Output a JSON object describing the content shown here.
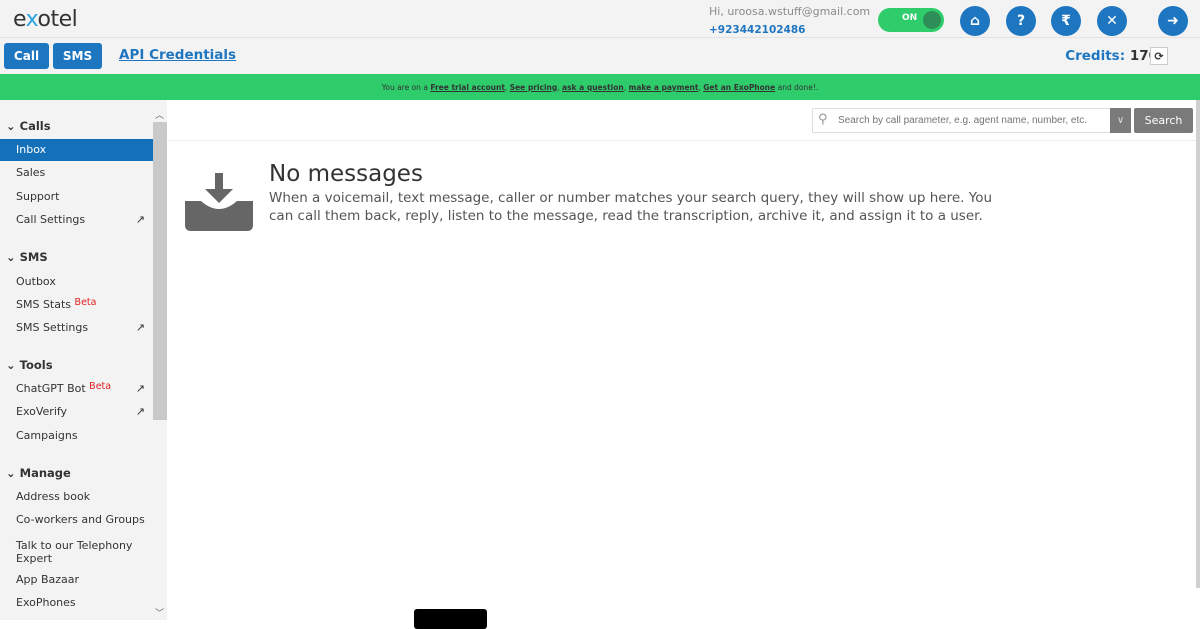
{
  "header": {
    "logo": {
      "prefix": "e",
      "x": "x",
      "suffix": "otel"
    },
    "greeting": "Hi, uroosa.wstuff@gmail.com",
    "phone": "+923442102486",
    "toggle_label": "ON",
    "icons": [
      "home-icon",
      "help-icon",
      "rupee-icon",
      "tools-icon",
      "logout-icon"
    ],
    "icon_glyphs": {
      "home": "⌂",
      "help": "?",
      "rupee": "₹",
      "tools": "✕",
      "logout": "➜"
    }
  },
  "toolbar": {
    "call_label": "Call",
    "sms_label": "SMS",
    "api_label": "API Credentials",
    "credits_label": "Credits:",
    "credits_value": "170",
    "refresh_glyph": "⟳"
  },
  "banner": {
    "prefix": "You are on a",
    "free_trial": "Free trial account",
    "see_pricing": "See pricing",
    "ask": "ask a question",
    "payment": "make a payment",
    "exophone": "Get an ExoPhone",
    "suffix": "and done!."
  },
  "sidebar": {
    "sections": [
      {
        "title": "Calls",
        "items": [
          {
            "label": "Inbox",
            "active": true
          },
          {
            "label": "Sales"
          },
          {
            "label": "Support"
          },
          {
            "label": "Call Settings",
            "external": true
          }
        ]
      },
      {
        "title": "SMS",
        "items": [
          {
            "label": "Outbox"
          },
          {
            "label": "SMS Stats",
            "badge": "Beta"
          },
          {
            "label": "SMS Settings",
            "external": true
          }
        ]
      },
      {
        "title": "Tools",
        "items": [
          {
            "label": "ChatGPT Bot",
            "badge": "Beta",
            "external": true
          },
          {
            "label": "ExoVerify",
            "external": true
          },
          {
            "label": "Campaigns"
          }
        ]
      },
      {
        "title": "Manage",
        "items": [
          {
            "label": "Address book"
          },
          {
            "label": "Co-workers and Groups"
          },
          {
            "label": "Talk to our Telephony Expert"
          },
          {
            "label": "App Bazaar"
          },
          {
            "label": "ExoPhones"
          }
        ]
      }
    ]
  },
  "search": {
    "placeholder": "Search by call parameter, e.g. agent name, number, etc.",
    "value": "",
    "button_label": "Search"
  },
  "empty_state": {
    "title": "No messages",
    "description": "When a voicemail, text message, caller or number matches your search query, they will show up here. You can call them back, reply, listen to the message, read the transcription, archive it, and assign it to a user."
  },
  "colors": {
    "brand_blue": "#1f76c0",
    "banner_green": "#2ecc6b",
    "beta_red": "#e02020"
  }
}
